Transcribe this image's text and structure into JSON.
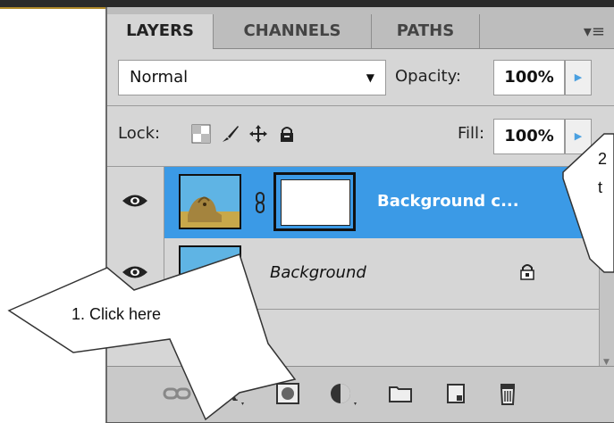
{
  "tabs": [
    {
      "label": "LAYERS",
      "active": true
    },
    {
      "label": "CHANNELS",
      "active": false
    },
    {
      "label": "PATHS",
      "active": false
    }
  ],
  "panel_menu_icon": "panel-menu-icon",
  "blend_mode": "Normal",
  "opacity_label": "Opacity:",
  "opacity_value": "100%",
  "lock_label": "Lock:",
  "fill_label": "Fill:",
  "fill_value": "100%",
  "layers": [
    {
      "name": "Background c...",
      "selected": true,
      "visible": true,
      "has_mask": true,
      "locked": false
    },
    {
      "name": "Background",
      "selected": false,
      "visible": true,
      "has_mask": false,
      "locked": true
    }
  ],
  "footer_icons": [
    "link-layers-icon",
    "fx-icon",
    "add-mask-icon",
    "adjustment-layer-icon",
    "group-folder-icon",
    "new-layer-icon",
    "trash-icon"
  ],
  "callouts": {
    "one": "1. Click here",
    "two_partial_top": "2",
    "two_partial_bottom": "t"
  },
  "colors": {
    "selected_layer": "#3b9ae6",
    "panel_bg": "#d6d6d6"
  }
}
